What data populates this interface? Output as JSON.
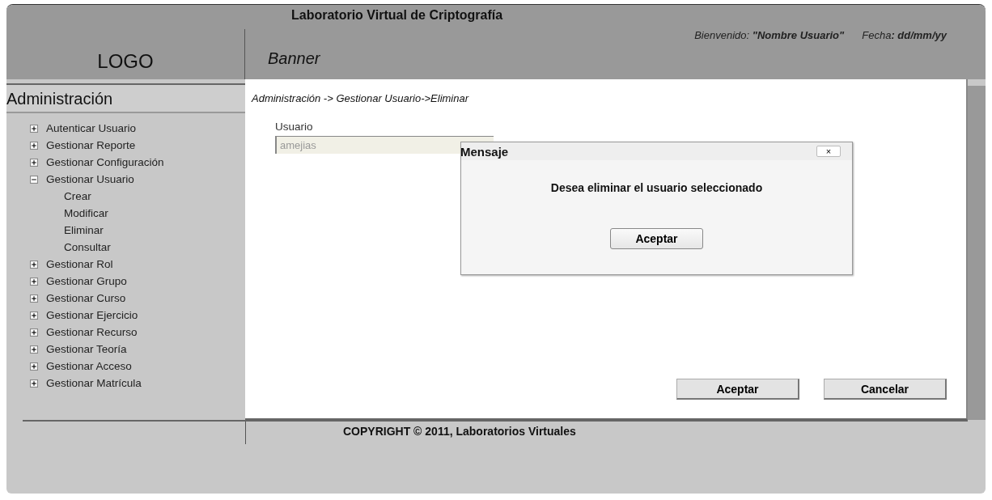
{
  "header": {
    "title": "Laboratorio Virtual de Criptografía",
    "logo": "LOGO",
    "banner": "Banner",
    "welcome_label": "Bienvenido:",
    "user_name": "\"Nombre Usuario\"",
    "date_label": "Fecha",
    "date_value": ": dd/mm/yy"
  },
  "sidebar": {
    "title": "Administración",
    "items": [
      {
        "label": "Autenticar Usuario",
        "expanded": false
      },
      {
        "label": "Gestionar Reporte",
        "expanded": false
      },
      {
        "label": "Gestionar Configuración",
        "expanded": false
      },
      {
        "label": "Gestionar Usuario",
        "expanded": true,
        "children": [
          {
            "label": "Crear"
          },
          {
            "label": "Modificar"
          },
          {
            "label": "Eliminar"
          },
          {
            "label": "Consultar"
          }
        ]
      },
      {
        "label": "Gestionar Rol",
        "expanded": false
      },
      {
        "label": "Gestionar Grupo",
        "expanded": false
      },
      {
        "label": "Gestionar Curso",
        "expanded": false
      },
      {
        "label": "Gestionar Ejercicio",
        "expanded": false
      },
      {
        "label": "Gestionar Recurso",
        "expanded": false
      },
      {
        "label": "Gestionar Teoría",
        "expanded": false
      },
      {
        "label": "Gestionar Acceso",
        "expanded": false
      },
      {
        "label": "Gestionar Matrícula",
        "expanded": false
      }
    ]
  },
  "breadcrumb": "Administración ->  Gestionar Usuario->Eliminar",
  "form": {
    "label": "Usuario",
    "value": "amejias"
  },
  "buttons": [
    "Aceptar",
    "Cancelar"
  ],
  "dialog": {
    "title": "Mensaje",
    "close": "×",
    "message": "Desea eliminar el usuario seleccionado",
    "button": "Aceptar"
  },
  "footer": "COPYRIGHT © 2011, Laboratorios Virtuales"
}
